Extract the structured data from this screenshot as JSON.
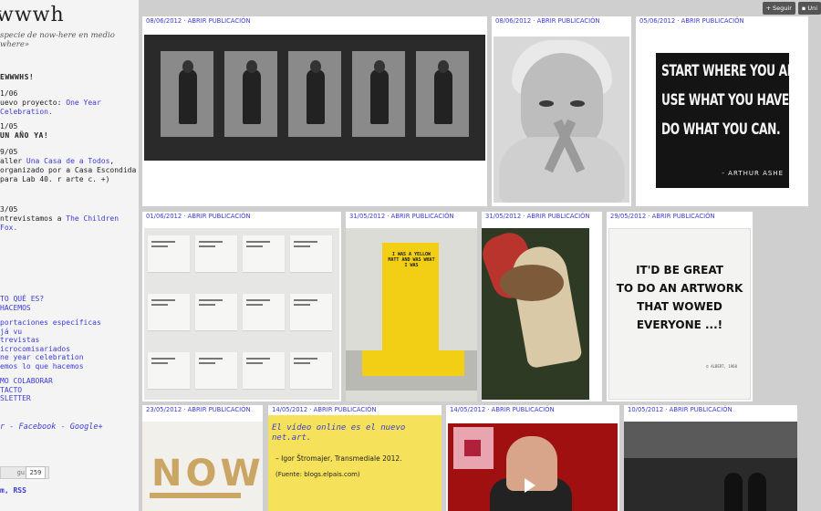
{
  "site": {
    "title": "wwwh",
    "tagline": "specie de now-here en medio where»"
  },
  "sidebar": {
    "news_heading": "EWWWHS!",
    "news": [
      {
        "date": "1/06",
        "prefix": "uevo proyecto: ",
        "link": "One Year Celebration."
      },
      {
        "date": "1/05",
        "title": "UN AÑO YA!"
      },
      {
        "date": "9/05",
        "prefix": "aller ",
        "link": "Una Casa de a Todos",
        "rest": ", organizado por a Casa Escondida para Lab 40. r arte c. +)"
      },
      {
        "date": "3/05",
        "prefix": "ntrevistamos a ",
        "link": "The Children Fox."
      }
    ],
    "nav": [
      "TO QUÉ ES?",
      "HACEMOS",
      "",
      "portaciones específicas",
      "já vu",
      "trevistas",
      "icrocomisariados",
      "ne year celebration",
      "emos lo que hacemos",
      "",
      "MO COLABORAR",
      "TACTO",
      "SLETTER"
    ],
    "social": "r - Facebook - Google+",
    "follow_label": "guir",
    "follow_count": "259",
    "rss": "m, RSS"
  },
  "top_controls": {
    "follow": "Seguir",
    "other": "Uni"
  },
  "cards": {
    "c1": {
      "date": "08/06/2012",
      "action": "ABRIR PUBLICACIÓN"
    },
    "c2": {
      "date": "08/06/2012",
      "action": "ABRIR PUBLICACIÓN"
    },
    "c3": {
      "date": "05/06/2012",
      "action": "ABRIR PUBLICACIÓN",
      "quote_lines": [
        "START WHERE YOU ARE.",
        "USE WHAT YOU HAVE.",
        "DO WHAT YOU CAN."
      ],
      "author": "- ARTHUR ASHE"
    },
    "c4": {
      "date": "01/06/2012",
      "action": "ABRIR PUBLICACIÓN"
    },
    "c5": {
      "date": "31/05/2012",
      "action": "ABRIR PUBLICACIÓN",
      "banner_text": "I WAS A YELLOW MATT AND WAS WHAT I WAS"
    },
    "c6": {
      "date": "31/05/2012",
      "action": "ABRIR PUBLICACIÓN"
    },
    "c7": {
      "date": "29/05/2012",
      "action": "ABRIR PUBLICACIÓN",
      "lines": [
        "IT'D BE GREAT",
        "TO DO AN ARTWORK",
        "THAT WOWED",
        "EVERYONE ...!"
      ],
      "credit": "© ALBERT, 1960"
    },
    "c8": {
      "date": "23/05/2012",
      "action": "ABRIR PUBLICACIÓN",
      "art_text": "NOW"
    },
    "c9": {
      "date": "14/05/2012",
      "action": "ABRIR PUBLICACIÓN",
      "title": "El vídeo online es el nuevo net.art.",
      "subtitle": "– Igor Štromajer, Transmediale 2012.",
      "source": "(Fuente: blogs.elpais.com)"
    },
    "c10": {
      "date": "14/05/2012",
      "action": "ABRIR PUBLICACIÓN"
    },
    "c11": {
      "date": "10/05/2012",
      "action": "ABRIR PUBLICACIÓN"
    }
  },
  "colors": {
    "link": "#3b3bd6",
    "background": "#cfcfcf",
    "yellow": "#f2cf14"
  }
}
